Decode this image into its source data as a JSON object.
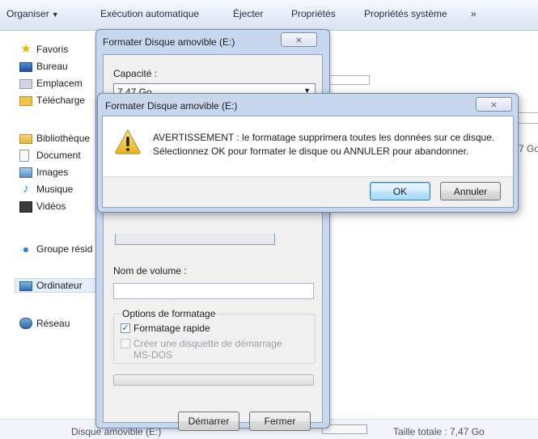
{
  "toolbar": {
    "organize": "Organiser",
    "autoplay": "Exécution automatique",
    "eject": "Éjecter",
    "properties": "Propriétés",
    "system_properties": "Propriétés système",
    "more": "»"
  },
  "nav": {
    "favorites": "Favoris",
    "desktop": "Bureau",
    "places": "Emplacem",
    "downloads": "Télécharge",
    "libraries": "Bibliothèque",
    "documents": "Document",
    "images": "Images",
    "music": "Musique",
    "videos": "Vidéos",
    "homegroup": "Groupe résid",
    "computer": "Ordinateur",
    "network": "Réseau"
  },
  "content": {
    "fragment_gb": "7 Go"
  },
  "status": {
    "drive_label": "Disque amovible (E:)",
    "total_size": "Taille totale : 7,47 Go"
  },
  "format_dialog": {
    "title": "Formater Disque amovible (E:)",
    "close_symbol": "⨯",
    "capacity_label": "Capacité :",
    "capacity_value": "7,47 Go",
    "volume_label": "Nom de volume :",
    "volume_value": "",
    "options_label": "Options de formatage",
    "quick_format_label": "Formatage rapide",
    "quick_format_checked": true,
    "boot_disk_line1": "Créer une disquette de démarrage",
    "boot_disk_line2": "MS-DOS",
    "boot_disk_checked": false,
    "start_button": "Démarrer",
    "close_button": "Fermer"
  },
  "warning_dialog": {
    "title": "Formater Disque amovible (E:)",
    "close_symbol": "⨯",
    "message_line1": "AVERTISSEMENT : le formatage supprimera toutes les données sur ce disque.",
    "message_line2": "Sélectionnez OK pour formater le disque ou ANNULER pour abandonner.",
    "ok_button": "OK",
    "cancel_button": "Annuler"
  }
}
